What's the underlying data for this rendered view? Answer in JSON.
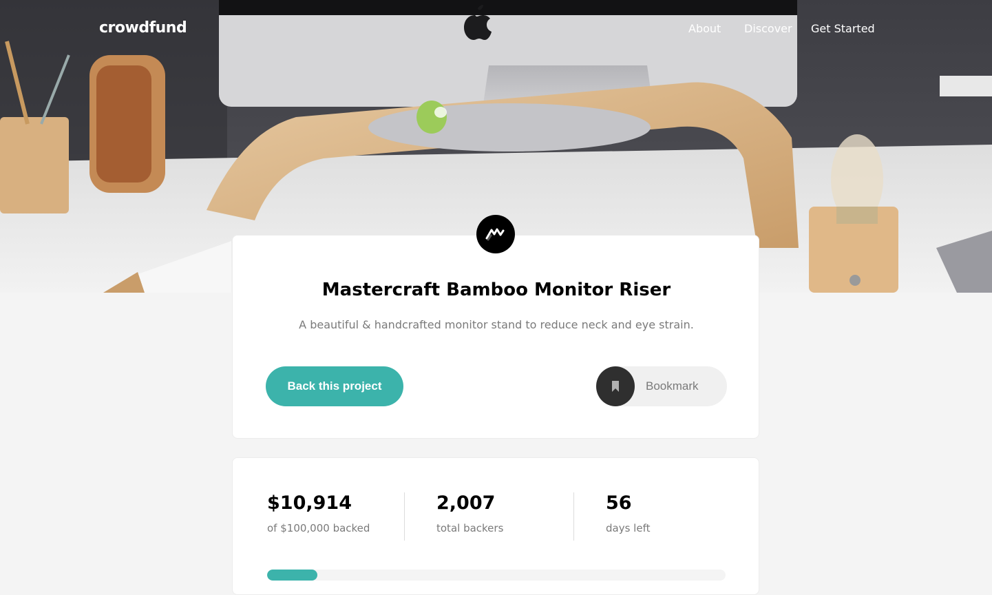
{
  "nav": {
    "logo": "crowdfund",
    "links": [
      "About",
      "Discover",
      "Get Started"
    ]
  },
  "project": {
    "title": "Mastercraft Bamboo Monitor Riser",
    "description": "A beautiful & handcrafted monitor stand to reduce neck and eye strain.",
    "back_label": "Back this project",
    "bookmark_label": "Bookmark"
  },
  "stats": {
    "backed": {
      "value": "$10,914",
      "label": "of $100,000 backed"
    },
    "backers": {
      "value": "2,007",
      "label": "total backers"
    },
    "days": {
      "value": "56",
      "label": "days left"
    }
  },
  "progress": {
    "fraction": 0.109
  },
  "colors": {
    "accent": "#3cb3ab",
    "dark": "#2f2f2f",
    "muted_text": "#7a7a7a",
    "background": "#f4f4f4"
  },
  "icons": {
    "brand_mark": "mastercraft-logo-icon",
    "bookmark": "bookmark-icon"
  }
}
